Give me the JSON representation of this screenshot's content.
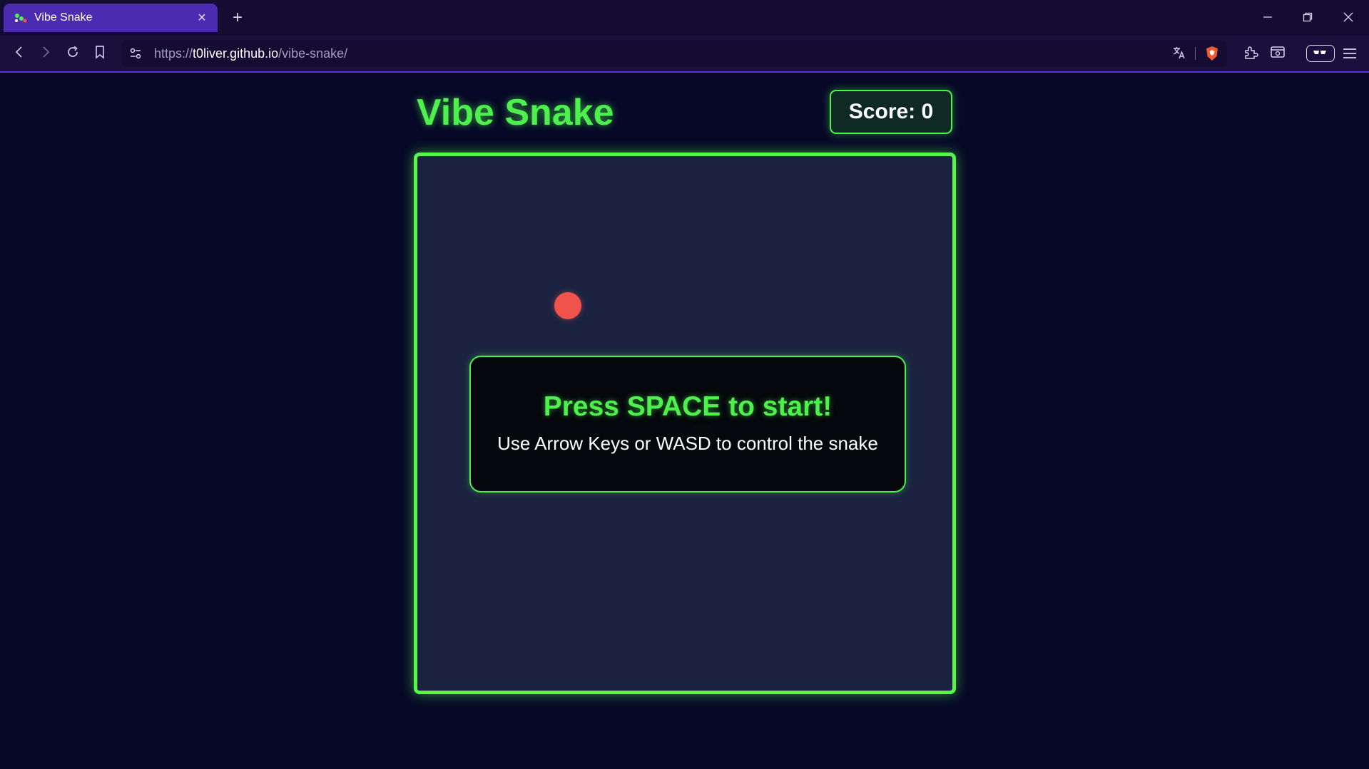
{
  "browser": {
    "tab": {
      "title": "Vibe Snake",
      "close_icon": "close-icon",
      "favicon": "snake-favicon"
    },
    "new_tab_icon": "plus-icon",
    "window_controls": [
      "minimize-icon",
      "restore-icon",
      "close-icon"
    ],
    "nav": [
      "back-icon",
      "forward-icon",
      "reload-icon",
      "bookmark-icon"
    ],
    "url": {
      "scheme": "https://",
      "host": "t0liver.github.io",
      "path": "/vibe-snake/"
    },
    "toolbar_icons": [
      "translate-icon",
      "brave-shield-icon",
      "extensions-icon",
      "sidebar-icon",
      "vpn-icon",
      "menu-icon"
    ],
    "accent": "#4c2bb3"
  },
  "game": {
    "title": "Vibe Snake",
    "score_label": "Score: 0",
    "overlay": {
      "title": "Press SPACE to start!",
      "subtitle": "Use Arrow Keys or WASD to control the snake"
    },
    "colors": {
      "accent": "#4ef04e",
      "food": "#f0534c",
      "board": "#1b2340",
      "page_bg": "#070827"
    }
  }
}
